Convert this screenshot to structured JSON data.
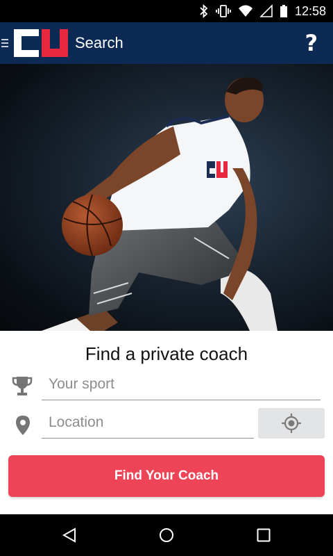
{
  "status_bar": {
    "time": "12:58",
    "icons": [
      "bluetooth-icon",
      "vibrate-icon",
      "wifi-icon",
      "signal-icon",
      "battery-icon"
    ]
  },
  "app_bar": {
    "logo_icon": "coachup-logo",
    "title": "Search",
    "help_label": "?",
    "background_color": "#0d2a55"
  },
  "hero": {
    "image": "basketball-player-dribbling",
    "jersey_text": "COACHUP"
  },
  "search": {
    "headline": "Find a private coach",
    "sport": {
      "icon": "trophy-icon",
      "value": "",
      "placeholder": "Your sport"
    },
    "location": {
      "icon": "map-pin-icon",
      "value": "",
      "placeholder": "Location",
      "locate_icon": "crosshair-icon"
    },
    "submit_label": "Find Your Coach",
    "accent_color": "#ee4457"
  },
  "nav_bar": {
    "buttons": [
      "back-icon",
      "home-icon",
      "recents-icon"
    ]
  }
}
